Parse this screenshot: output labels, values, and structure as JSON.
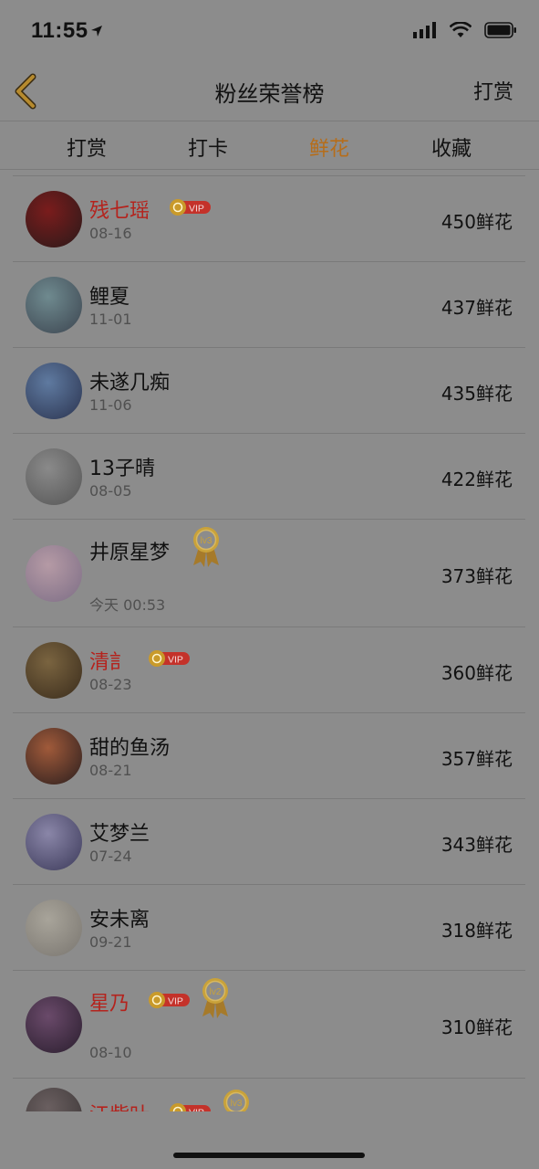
{
  "status": {
    "time": "11:55"
  },
  "nav": {
    "title": "粉丝荣誉榜",
    "right_label": "打赏"
  },
  "tabs": [
    {
      "label": "打赏",
      "active": false
    },
    {
      "label": "打卡",
      "active": false
    },
    {
      "label": "鲜花",
      "active": true
    },
    {
      "label": "收藏",
      "active": false
    }
  ],
  "colors": {
    "accent": "#b66d1a",
    "vip_name": "#b4231d",
    "vip_badge": "#c4322a",
    "medal": "#c9a23a"
  },
  "vip_text": "VIP",
  "rows": [
    {
      "name": "残七瑶",
      "date": "08-16",
      "count": "450鲜花",
      "vip": true,
      "medal": null,
      "avatar_colors": [
        "#7a1c1c",
        "#2a1a1a"
      ]
    },
    {
      "name": "鲤夏",
      "date": "11-01",
      "count": "437鲜花",
      "vip": false,
      "medal": null,
      "avatar_colors": [
        "#6f8a8f",
        "#3c4550"
      ]
    },
    {
      "name": "未遂几痴",
      "date": "11-06",
      "count": "435鲜花",
      "vip": false,
      "medal": null,
      "avatar_colors": [
        "#5f7aa0",
        "#2b3450"
      ]
    },
    {
      "name": "13子晴",
      "date": "08-05",
      "count": "422鲜花",
      "vip": false,
      "medal": null,
      "avatar_colors": [
        "#8a8a8a",
        "#555"
      ]
    },
    {
      "name": "井原星梦",
      "date": "今天 00:53",
      "count": "373鲜花",
      "vip": false,
      "medal": "lv3",
      "avatar_colors": [
        "#b59aa5",
        "#7d6e86"
      ]
    },
    {
      "name": "清訁",
      "date": "08-23",
      "count": "360鲜花",
      "vip": true,
      "medal": null,
      "avatar_colors": [
        "#7a6440",
        "#3a2c1c"
      ]
    },
    {
      "name": "甜的鱼汤",
      "date": "08-21",
      "count": "357鲜花",
      "vip": false,
      "medal": null,
      "avatar_colors": [
        "#a05a3a",
        "#2a1e1e"
      ]
    },
    {
      "name": "艾梦兰",
      "date": "07-24",
      "count": "343鲜花",
      "vip": false,
      "medal": null,
      "avatar_colors": [
        "#8a86a8",
        "#3c3a5a"
      ]
    },
    {
      "name": "安未离",
      "date": "09-21",
      "count": "318鲜花",
      "vip": false,
      "medal": null,
      "avatar_colors": [
        "#a8a49a",
        "#7a7670"
      ]
    },
    {
      "name": "星乃",
      "date": "08-10",
      "count": "310鲜花",
      "vip": true,
      "medal": "lv2",
      "avatar_colors": [
        "#6a4a6a",
        "#2a1e2e"
      ]
    },
    {
      "name": "江紫叶",
      "date": "",
      "count": "",
      "vip": true,
      "medal": "lv3",
      "avatar_colors": [
        "#6a5f60",
        "#3a3535"
      ]
    }
  ]
}
